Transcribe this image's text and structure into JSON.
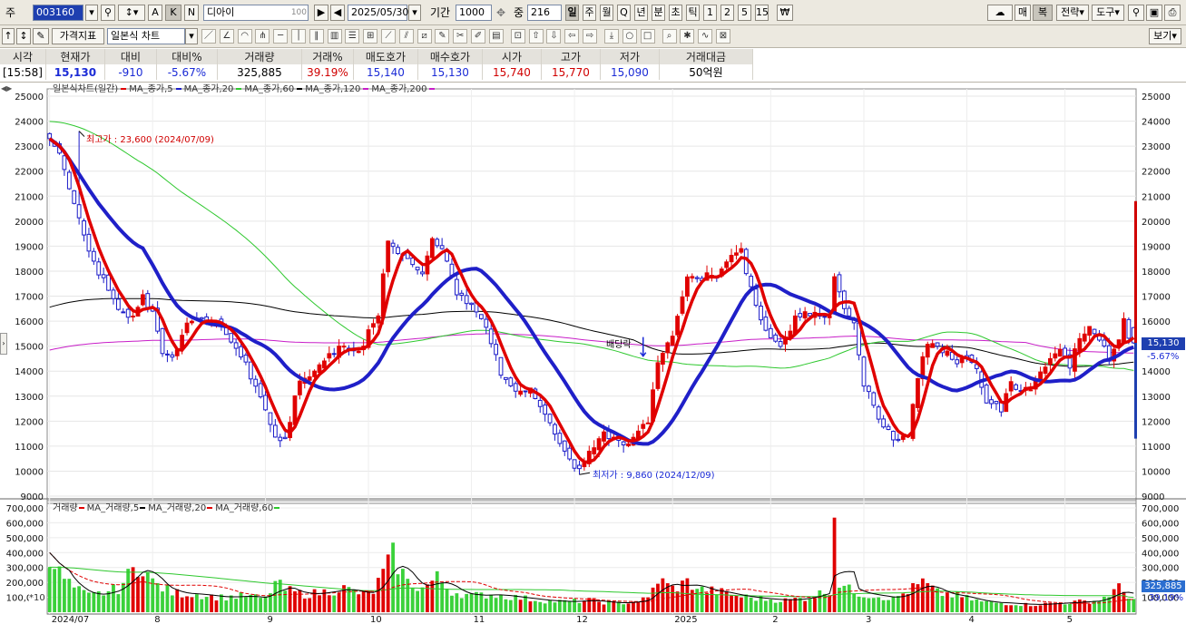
{
  "toolbar1": {
    "type_label": "주",
    "code": "003160",
    "btn_k": "K",
    "btn_n": "N",
    "btn_a": "A",
    "name": "디아이",
    "name_badge": "100",
    "date": "2025/05/30",
    "period_label": "기간",
    "period_value": "1000",
    "count_label": "중",
    "count_value": "216",
    "intervals": [
      "일",
      "주",
      "월",
      "Q",
      "년",
      "분",
      "초",
      "틱",
      "1",
      "2",
      "5",
      "15"
    ],
    "right_buttons": [
      "매",
      "복",
      "전략",
      "도구"
    ]
  },
  "toolbar2": {
    "indicator_btn": "가격지표",
    "chart_type": "일본식 차트",
    "view_btn": "보기"
  },
  "quote": {
    "headers": [
      "시각",
      "현재가",
      "대비",
      "대비%",
      "거래량",
      "거래%",
      "매도호가",
      "매수호가",
      "시가",
      "고가",
      "저가",
      "거래대금"
    ],
    "values": [
      "[15:58]",
      "15,130",
      "-910",
      "-5.67%",
      "325,885",
      "39.19%",
      "15,140",
      "15,130",
      "15,740",
      "15,770",
      "15,090",
      "50억원"
    ],
    "colors": [
      "#000000",
      "#1b2bd6",
      "#1b2bd6",
      "#1b2bd6",
      "#000000",
      "#d00000",
      "#1b2bd6",
      "#1b2bd6",
      "#d00000",
      "#d00000",
      "#1b2bd6",
      "#000000"
    ]
  },
  "legend_price": [
    "일본식차트(일간)",
    "MA_종가,5",
    "MA_종가,20",
    "MA_종가,60",
    "MA_종가,120",
    "MA_종가,200"
  ],
  "legend_volume": [
    "거래량",
    "MA_거래량,5",
    "MA_거래량,20",
    "MA_거래량,60"
  ],
  "annotations": {
    "high": "최고가 : 23,600 (2024/07/09)",
    "low": "최저가 : 9,860 (2024/12/09)",
    "dividend": "배당락",
    "cur_price": "15,130",
    "cur_pct": "-5.67%",
    "vol_now": "325,885",
    "vol_pct": "39.19%",
    "vol_unit": "*10"
  },
  "colors": {
    "up": "#e00000",
    "down": "#1a1ac8",
    "ma5": "#e00000",
    "ma20": "#1f1fc8",
    "ma60": "#2ec82e",
    "ma120": "#000000",
    "ma200": "#c81ec8",
    "vol_up": "#e00000",
    "vol_down": "#3ad13a",
    "accent": "#1e3fb0"
  },
  "chart_data": {
    "type": "candlestick",
    "price_axis": {
      "ticks": [
        9000,
        10000,
        11000,
        12000,
        13000,
        14000,
        15000,
        16000,
        17000,
        18000,
        19000,
        20000,
        21000,
        22000,
        23000,
        24000,
        25000
      ],
      "range": [
        9000,
        25000
      ]
    },
    "volume_axis": {
      "ticks": [
        100000,
        200000,
        300000,
        400000,
        500000,
        600000,
        700000
      ],
      "range": [
        0,
        700000
      ]
    },
    "x_labels": [
      "2024/07",
      "8",
      "9",
      "10",
      "11",
      "12",
      "2025",
      "2",
      "3",
      "4",
      "5"
    ],
    "x_label_days": [
      0,
      21,
      44,
      65,
      86,
      107,
      127,
      147,
      166,
      187,
      207
    ],
    "days": 216,
    "anchors": {
      "close": [
        [
          0,
          23300
        ],
        [
          2,
          22700
        ],
        [
          5,
          20800
        ],
        [
          8,
          18800
        ],
        [
          11,
          17600
        ],
        [
          14,
          16500
        ],
        [
          17,
          16100
        ],
        [
          19,
          17000
        ],
        [
          21,
          16400
        ],
        [
          23,
          14800
        ],
        [
          25,
          14500
        ],
        [
          28,
          15900
        ],
        [
          31,
          16200
        ],
        [
          34,
          15800
        ],
        [
          37,
          15300
        ],
        [
          40,
          14200
        ],
        [
          43,
          13000
        ],
        [
          46,
          11300
        ],
        [
          48,
          11300
        ],
        [
          51,
          13600
        ],
        [
          54,
          14000
        ],
        [
          57,
          14700
        ],
        [
          60,
          15000
        ],
        [
          63,
          14800
        ],
        [
          65,
          15500
        ],
        [
          67,
          16300
        ],
        [
          69,
          19200
        ],
        [
          71,
          18800
        ],
        [
          74,
          18300
        ],
        [
          76,
          17800
        ],
        [
          78,
          19300
        ],
        [
          80,
          19000
        ],
        [
          83,
          17200
        ],
        [
          86,
          16700
        ],
        [
          89,
          15700
        ],
        [
          92,
          13900
        ],
        [
          95,
          13200
        ],
        [
          98,
          13200
        ],
        [
          101,
          12300
        ],
        [
          104,
          11200
        ],
        [
          106,
          10400
        ],
        [
          108,
          10100
        ],
        [
          110,
          10700
        ],
        [
          113,
          11400
        ],
        [
          116,
          11100
        ],
        [
          118,
          11000
        ],
        [
          120,
          11600
        ],
        [
          122,
          12100
        ],
        [
          124,
          14400
        ],
        [
          127,
          15500
        ],
        [
          130,
          17700
        ],
        [
          133,
          17700
        ],
        [
          136,
          17900
        ],
        [
          139,
          18600
        ],
        [
          141,
          18900
        ],
        [
          143,
          17200
        ],
        [
          146,
          15500
        ],
        [
          149,
          15000
        ],
        [
          152,
          16100
        ],
        [
          155,
          16300
        ],
        [
          157,
          16400
        ],
        [
          159,
          16200
        ],
        [
          160,
          17700
        ],
        [
          162,
          16500
        ],
        [
          164,
          15800
        ],
        [
          166,
          13500
        ],
        [
          169,
          12200
        ],
        [
          172,
          11400
        ],
        [
          175,
          11400
        ],
        [
          177,
          13700
        ],
        [
          179,
          15200
        ],
        [
          181,
          15000
        ],
        [
          183,
          14800
        ],
        [
          185,
          14300
        ],
        [
          187,
          14700
        ],
        [
          189,
          14100
        ],
        [
          191,
          12800
        ],
        [
          194,
          12500
        ],
        [
          196,
          13700
        ],
        [
          198,
          13200
        ],
        [
          200,
          13400
        ],
        [
          203,
          14300
        ],
        [
          206,
          14900
        ],
        [
          208,
          14300
        ],
        [
          210,
          15300
        ],
        [
          212,
          15700
        ],
        [
          214,
          15300
        ],
        [
          216,
          14400
        ],
        [
          218,
          15200
        ],
        [
          219,
          16100
        ],
        [
          220,
          15400
        ],
        [
          221,
          15130
        ]
      ],
      "volume": [
        [
          0,
          400000
        ],
        [
          2,
          260000
        ],
        [
          5,
          160000
        ],
        [
          8,
          110000
        ],
        [
          11,
          130000
        ],
        [
          14,
          160000
        ],
        [
          17,
          280000
        ],
        [
          19,
          320000
        ],
        [
          21,
          200000
        ],
        [
          25,
          130000
        ],
        [
          30,
          120000
        ],
        [
          35,
          100000
        ],
        [
          40,
          110000
        ],
        [
          44,
          90000
        ],
        [
          46,
          200000
        ],
        [
          48,
          150000
        ],
        [
          52,
          120000
        ],
        [
          55,
          130000
        ],
        [
          60,
          160000
        ],
        [
          64,
          120000
        ],
        [
          66,
          140000
        ],
        [
          68,
          260000
        ],
        [
          70,
          380000
        ],
        [
          73,
          200000
        ],
        [
          76,
          160000
        ],
        [
          79,
          230000
        ],
        [
          82,
          140000
        ],
        [
          86,
          110000
        ],
        [
          90,
          120000
        ],
        [
          95,
          100000
        ],
        [
          100,
          80000
        ],
        [
          105,
          70000
        ],
        [
          110,
          80000
        ],
        [
          115,
          60000
        ],
        [
          119,
          70000
        ],
        [
          122,
          90000
        ],
        [
          124,
          220000
        ],
        [
          127,
          160000
        ],
        [
          130,
          200000
        ],
        [
          133,
          150000
        ],
        [
          136,
          140000
        ],
        [
          140,
          110000
        ],
        [
          145,
          90000
        ],
        [
          150,
          80000
        ],
        [
          155,
          100000
        ],
        [
          159,
          150000
        ],
        [
          160,
          690000
        ],
        [
          161,
          200000
        ],
        [
          163,
          150000
        ],
        [
          166,
          120000
        ],
        [
          169,
          110000
        ],
        [
          172,
          90000
        ],
        [
          176,
          160000
        ],
        [
          178,
          200000
        ],
        [
          181,
          130000
        ],
        [
          185,
          110000
        ],
        [
          190,
          70000
        ],
        [
          195,
          60000
        ],
        [
          200,
          50000
        ],
        [
          205,
          60000
        ],
        [
          210,
          70000
        ],
        [
          214,
          80000
        ],
        [
          218,
          160000
        ],
        [
          221,
          90000
        ]
      ]
    },
    "extremes": {
      "high": 23600,
      "low": 9860
    }
  }
}
